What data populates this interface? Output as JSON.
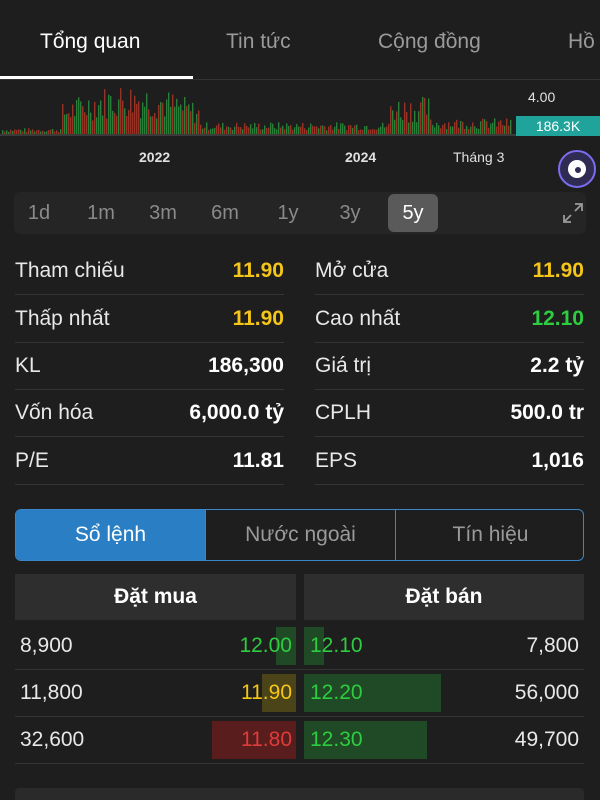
{
  "tabs": [
    "Tổng quan",
    "Tin tức",
    "Cộng đồng",
    "Hồ"
  ],
  "chart": {
    "year_labels": [
      "2022",
      "2024"
    ],
    "month_label": "Tháng 3",
    "price_label": "4.00",
    "volume_tag": "186.3K",
    "colors": {
      "up": "#2ea043",
      "down": "#c0392b",
      "tag": "#1fa39a"
    }
  },
  "ranges": [
    "1d",
    "1m",
    "3m",
    "6m",
    "1y",
    "3y",
    "5y"
  ],
  "active_range": "5y",
  "stats": {
    "left": [
      {
        "label": "Tham chiếu",
        "value": "11.90",
        "color": "#f5c518"
      },
      {
        "label": "Thấp nhất",
        "value": "11.90",
        "color": "#f5c518"
      },
      {
        "label": "KL",
        "value": "186,300",
        "color": "#ffffff"
      },
      {
        "label": "Vốn hóa",
        "value": "6,000.0 tỷ",
        "color": "#ffffff"
      },
      {
        "label": "P/E",
        "value": "11.81",
        "color": "#ffffff"
      }
    ],
    "right": [
      {
        "label": "Mở cửa",
        "value": "11.90",
        "color": "#f5c518"
      },
      {
        "label": "Cao nhất",
        "value": "12.10",
        "color": "#2ecc40"
      },
      {
        "label": "Giá trị",
        "value": "2.2 tỷ",
        "color": "#ffffff"
      },
      {
        "label": "CPLH",
        "value": "500.0 tr",
        "color": "#ffffff"
      },
      {
        "label": "EPS",
        "value": "1,016",
        "color": "#ffffff"
      }
    ]
  },
  "segments": [
    "Sổ lệnh",
    "Nước ngoài",
    "Tín hiệu"
  ],
  "active_segment": "Sổ lệnh",
  "orderbook": {
    "buy_header": "Đặt mua",
    "sell_header": "Đặt bán",
    "rows": [
      {
        "buy_vol": "8,900",
        "buy_price": "12.00",
        "buy_color": "#2ecc40",
        "buy_bar": 0.07,
        "sell_price": "12.10",
        "sell_color": "#2ecc40",
        "sell_vol": "7,800",
        "sell_bar": 0.07
      },
      {
        "buy_vol": "11,800",
        "buy_price": "11.90",
        "buy_color": "#f5c518",
        "buy_bar": 0.12,
        "sell_price": "12.20",
        "sell_color": "#2ecc40",
        "sell_vol": "56,000",
        "sell_bar": 0.49
      },
      {
        "buy_vol": "32,600",
        "buy_price": "11.80",
        "buy_color": "#e03b3b",
        "buy_bar": 0.3,
        "sell_price": "12.30",
        "sell_color": "#2ecc40",
        "sell_vol": "49,700",
        "sell_bar": 0.44
      }
    ]
  }
}
